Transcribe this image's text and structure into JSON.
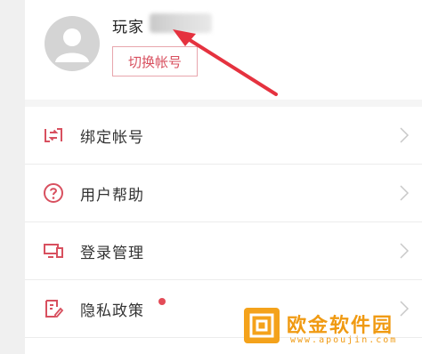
{
  "profile": {
    "player_label": "玩家",
    "switch_account_label": "切换帐号"
  },
  "menu": {
    "items": [
      {
        "label": "绑定帐号",
        "icon": "bind-account-icon"
      },
      {
        "label": "用户帮助",
        "icon": "help-question-icon"
      },
      {
        "label": "登录管理",
        "icon": "devices-icon"
      },
      {
        "label": "隐私政策",
        "icon": "privacy-edit-icon",
        "badge": "red-dot"
      }
    ]
  },
  "watermark": {
    "title": "欧金软件园",
    "url": "www.apoujin.com"
  },
  "colors": {
    "accent": "#d8505f",
    "arrow": "#e5323f",
    "watermark": "#f09a12"
  }
}
